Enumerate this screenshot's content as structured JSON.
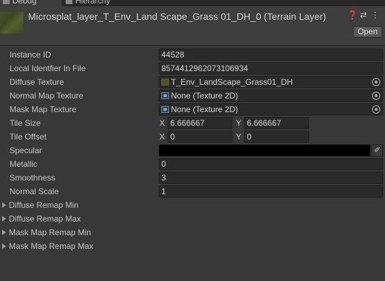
{
  "tabs": [
    {
      "label": "Debug",
      "icon": "debug-icon"
    },
    {
      "label": "Hierarchy",
      "icon": "hierarchy-icon"
    }
  ],
  "header": {
    "title": "Microsplat_layer_T_Env_Land Scape_Grass 01_DH_0 (Terrain Layer)",
    "open_label": "Open",
    "icons": [
      "help-icon",
      "preset-icon",
      "more-icon"
    ]
  },
  "properties": {
    "instance_id": {
      "label": "Instance ID",
      "value": "44528"
    },
    "local_identifier": {
      "label": "Local Identfier In File",
      "value": "8574412962073106934"
    },
    "diffuse_texture": {
      "label": "Diffuse Texture",
      "value": "T_Env_LandScape_Grass01_DH"
    },
    "normal_map_texture": {
      "label": "Normal Map Texture",
      "value": "None (Texture 2D)"
    },
    "mask_map_texture": {
      "label": "Mask Map Texture",
      "value": "None (Texture 2D)"
    },
    "tile_size": {
      "label": "Tile Size",
      "x_label": "X",
      "x": "6.666667",
      "y_label": "Y",
      "y": "6.666667"
    },
    "tile_offset": {
      "label": "Tile Offset",
      "x_label": "X",
      "x": "0",
      "y_label": "Y",
      "y": "0"
    },
    "specular": {
      "label": "Specular",
      "color": "#000000"
    },
    "metallic": {
      "label": "Metallic",
      "value": "0"
    },
    "smoothness": {
      "label": "Smoothness",
      "value": "3"
    },
    "normal_scale": {
      "label": "Normal Scale",
      "value": "1"
    }
  },
  "foldouts": [
    {
      "label": "Diffuse Remap Min"
    },
    {
      "label": "Diffuse Remap Max"
    },
    {
      "label": "Mask Map Remap Min"
    },
    {
      "label": "Mask Map Remap Max"
    }
  ]
}
